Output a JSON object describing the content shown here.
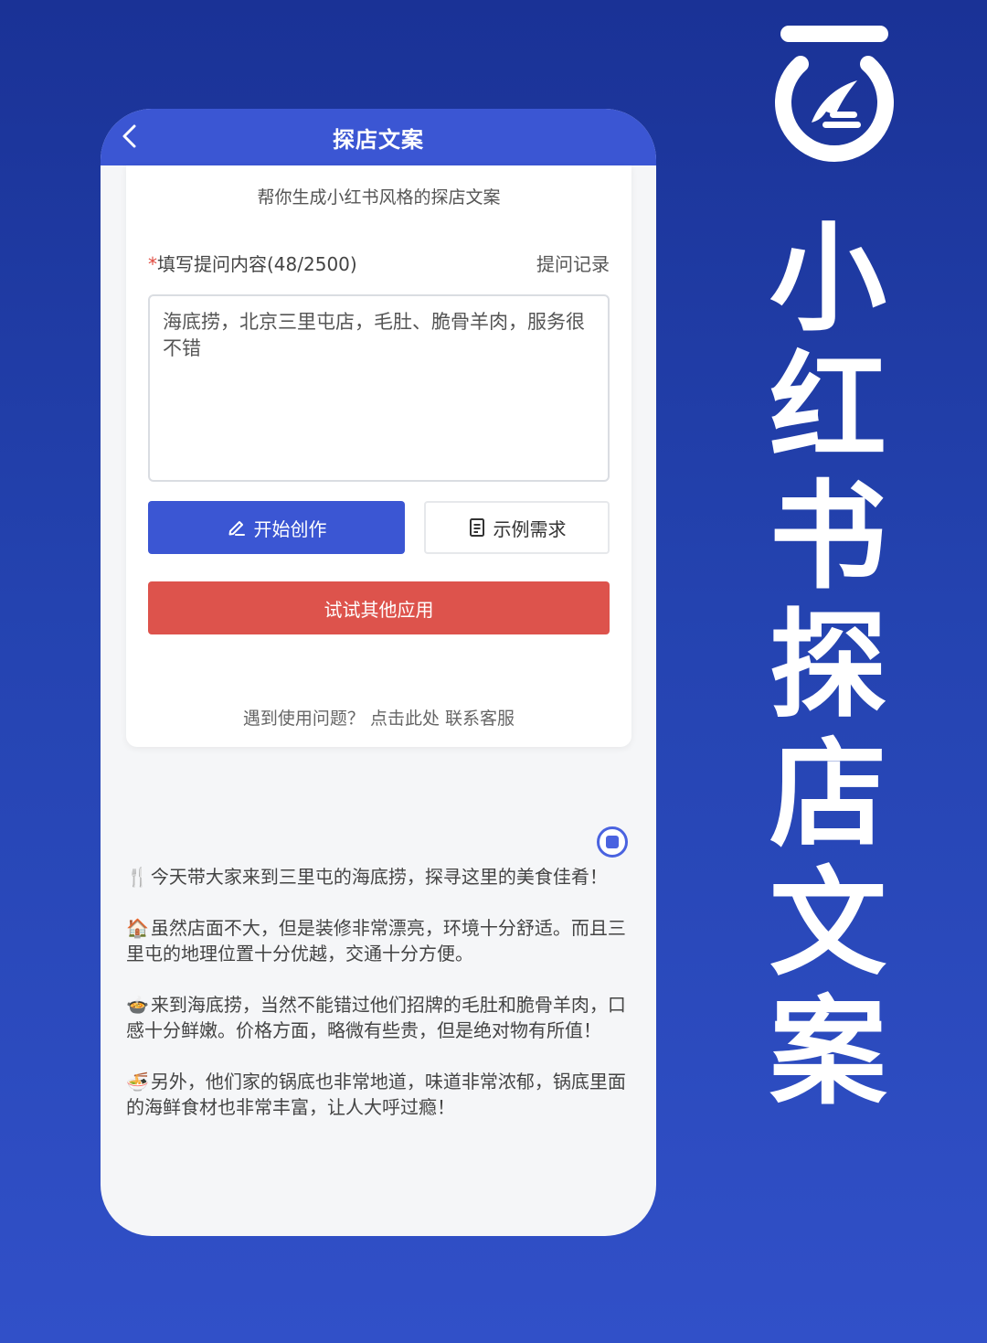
{
  "side": {
    "vertical_title": [
      "小",
      "红",
      "书",
      "探",
      "店",
      "文",
      "案"
    ]
  },
  "phone": {
    "header_title": "探店文案",
    "subtitle": "帮你生成小红书风格的探店文案",
    "field_required_mark": "*",
    "field_label": "填写提问内容(48/2500)",
    "history_link": "提问记录",
    "textarea_value": "海底捞，北京三里屯店，毛肚、脆骨羊肉，服务很不错",
    "btn_create": "开始创作",
    "btn_example": "示例需求",
    "btn_other": "试试其他应用",
    "help_question": "遇到使用问题？",
    "help_link1": "点击此处",
    "help_link2": "联系客服",
    "result_paragraphs": [
      {
        "emoji": "🍴",
        "text": "今天带大家来到三里屯的海底捞，探寻这里的美食佳肴！"
      },
      {
        "emoji": "🏠",
        "text": "虽然店面不大，但是装修非常漂亮，环境十分舒适。而且三里屯的地理位置十分优越，交通十分方便。"
      },
      {
        "emoji": "🍲",
        "text": "来到海底捞，当然不能错过他们招牌的毛肚和脆骨羊肉，口感十分鲜嫩。价格方面，略微有些贵，但是绝对物有所值！"
      },
      {
        "emoji": "🍜",
        "text": "另外，他们家的锅底也非常地道，味道非常浓郁，锅底里面的海鲜食材也非常丰富，让人大呼过瘾！"
      }
    ]
  },
  "colors": {
    "primary": "#3b56d3",
    "danger": "#dd534c",
    "background": "#2443b0"
  }
}
